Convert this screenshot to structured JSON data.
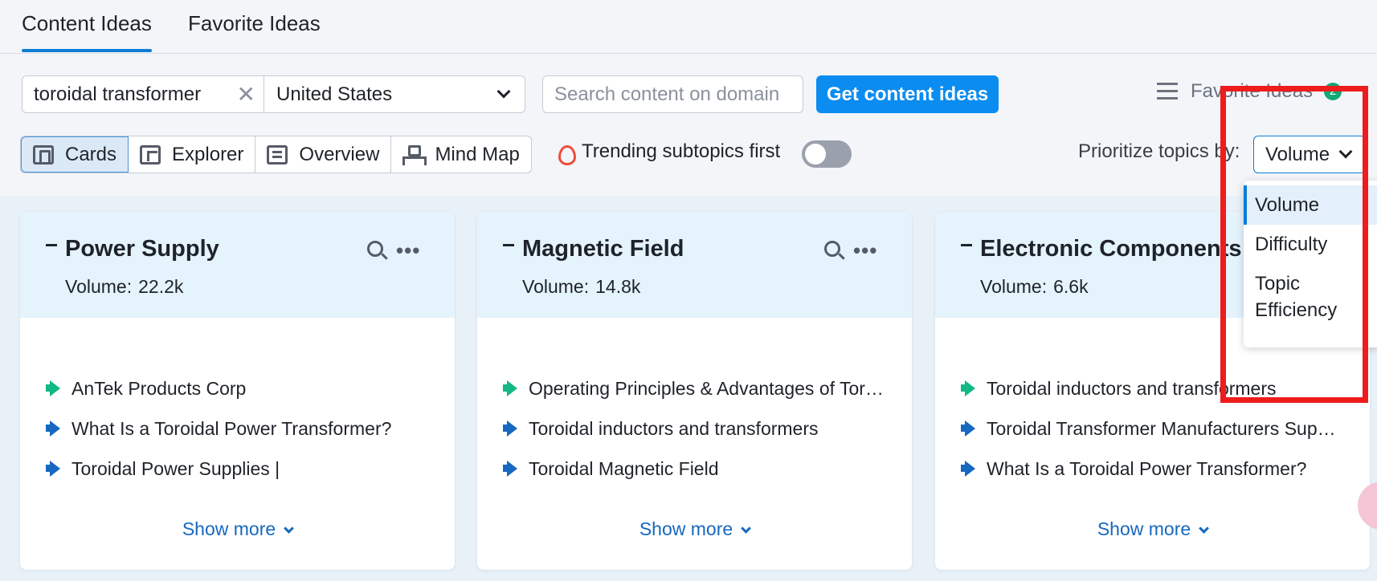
{
  "tabs": {
    "active": "Content Ideas",
    "second": "Favorite Ideas"
  },
  "search": {
    "keyword": "toroidal transformer",
    "country": "United States",
    "domain_placeholder": "Search content on domain",
    "get_button": "Get content ideas"
  },
  "favorites": {
    "label": "Favorite Ideas",
    "count": "2"
  },
  "views": {
    "cards": "Cards",
    "explorer": "Explorer",
    "overview": "Overview",
    "mindmap": "Mind Map"
  },
  "trending": {
    "label": "Trending subtopics first",
    "enabled": false
  },
  "prioritize": {
    "label": "Prioritize topics by:",
    "selected": "Volume",
    "options": [
      "Volume",
      "Difficulty",
      "Topic Efficiency"
    ]
  },
  "cards": [
    {
      "title": "Power Supply",
      "volume_label": "Volume:",
      "volume_value": "22.2k",
      "items": [
        {
          "text": "AnTek Products Corp",
          "icon": "megaphone-green-icon"
        },
        {
          "text": "What Is a Toroidal Power Transformer?",
          "icon": "megaphone-blue-icon"
        },
        {
          "text": "Toroidal Power Supplies |",
          "icon": "megaphone-blue-icon"
        }
      ],
      "show_more": "Show more"
    },
    {
      "title": "Magnetic Field",
      "volume_label": "Volume:",
      "volume_value": "14.8k",
      "items": [
        {
          "text": "Operating Principles & Advantages of Tor…",
          "icon": "megaphone-green-icon"
        },
        {
          "text": "Toroidal inductors and transformers",
          "icon": "megaphone-blue-icon"
        },
        {
          "text": "Toroidal Magnetic Field",
          "icon": "megaphone-blue-icon"
        }
      ],
      "show_more": "Show more"
    },
    {
      "title": "Electronic Components",
      "volume_label": "Volume:",
      "volume_value": "6.6k",
      "items": [
        {
          "text": "Toroidal inductors and transformers",
          "icon": "megaphone-green-icon"
        },
        {
          "text": "Toroidal Transformer Manufacturers Sup…",
          "icon": "megaphone-blue-icon"
        },
        {
          "text": "What Is a Toroidal Power Transformer?",
          "icon": "megaphone-blue-icon"
        }
      ],
      "show_more": "Show more"
    }
  ],
  "colors": {
    "accent": "#0a8cf0",
    "highlight": "#ee1c1c",
    "green_icon": "#12b886",
    "blue_icon": "#1668c0"
  }
}
